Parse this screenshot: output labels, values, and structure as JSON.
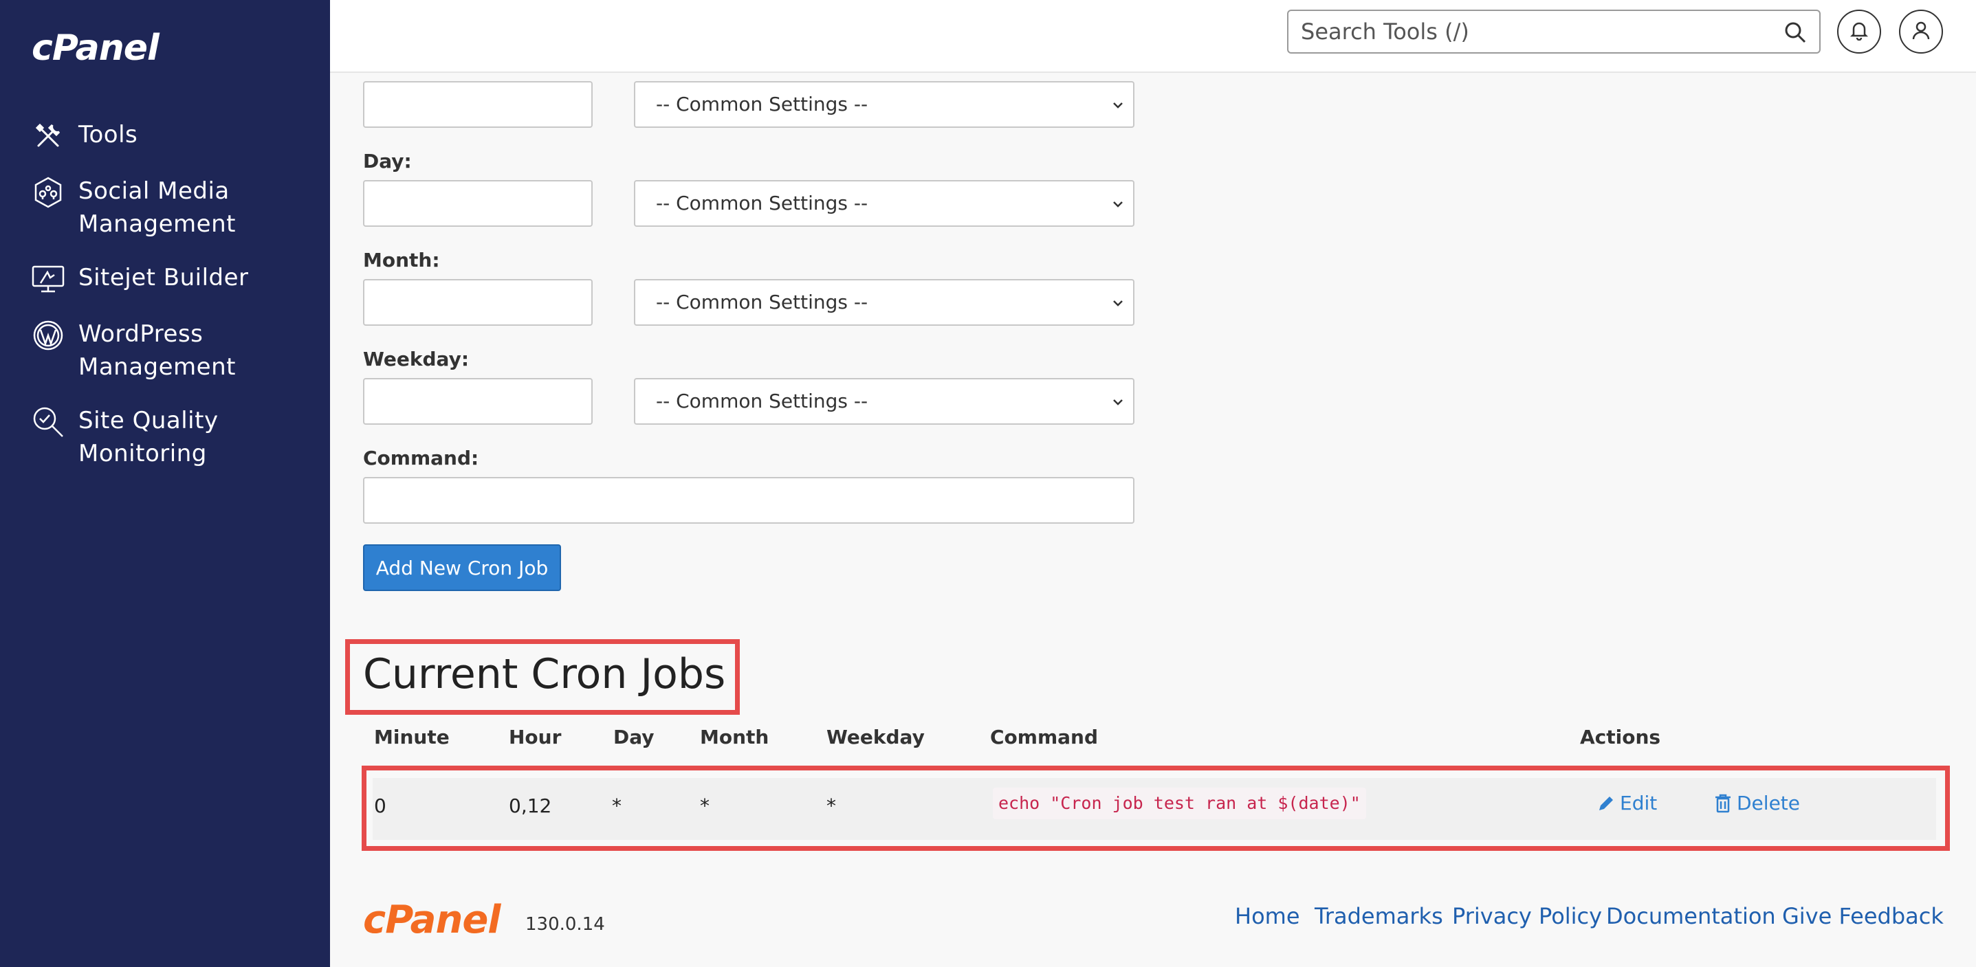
{
  "brand": {
    "logo_text": "cPanel"
  },
  "sidebar": {
    "items": [
      {
        "label": "Tools",
        "icon": "tools-icon"
      },
      {
        "label": "Social Media Management",
        "icon": "social-media-icon"
      },
      {
        "label": "Sitejet Builder",
        "icon": "sitejet-icon"
      },
      {
        "label": "WordPress Management",
        "icon": "wordpress-icon"
      },
      {
        "label": "Site Quality Monitoring",
        "icon": "site-quality-icon"
      }
    ]
  },
  "header": {
    "search_placeholder": "Search Tools (/)"
  },
  "form": {
    "common_settings": "-- Common Settings --",
    "day_label": "Day:",
    "month_label": "Month:",
    "weekday_label": "Weekday:",
    "command_label": "Command:",
    "add_button": "Add New Cron Job"
  },
  "cron": {
    "title": "Current Cron Jobs",
    "columns": [
      "Minute",
      "Hour",
      "Day",
      "Month",
      "Weekday",
      "Command",
      "Actions"
    ],
    "rows": [
      {
        "minute": "0",
        "hour": "0,12",
        "day": "*",
        "month": "*",
        "weekday": "*",
        "command": "echo \"Cron job test ran at $(date)\"",
        "edit": "Edit",
        "delete": "Delete"
      }
    ]
  },
  "footer": {
    "logo_text": "cPanel",
    "version": "130.0.14",
    "links": [
      "Home",
      "Trademarks",
      "Privacy Policy",
      "Documentation",
      "Give Feedback"
    ]
  },
  "colors": {
    "sidebar": "#1e2656",
    "accent": "#2f80d0",
    "highlight": "#e54b4b",
    "brand_orange": "#f36b21"
  }
}
